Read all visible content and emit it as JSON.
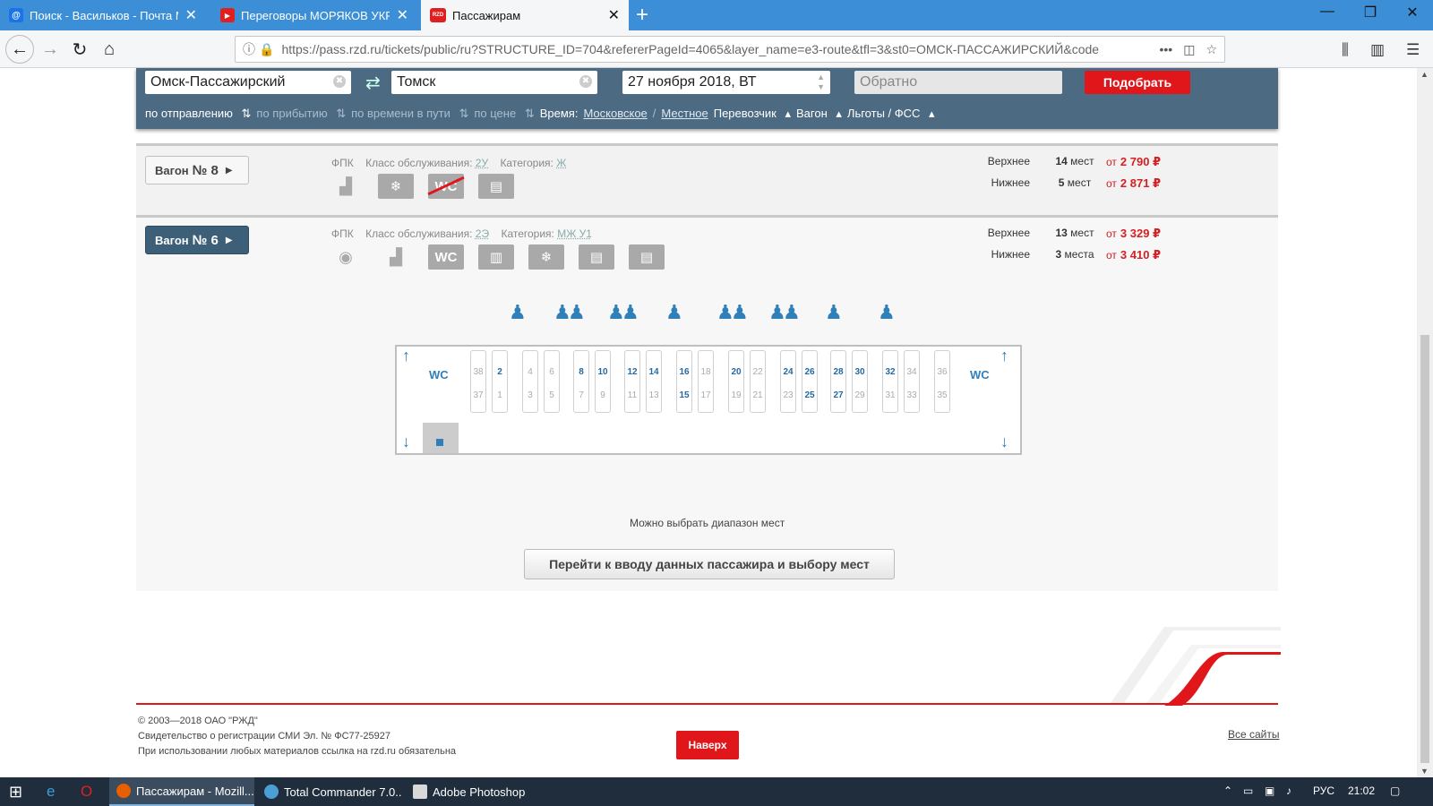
{
  "browser": {
    "tabs": [
      {
        "title": "Поиск - Васильков - Почта М",
        "fav": "@",
        "color": "#1a73e8"
      },
      {
        "title": "Переговоры МОРЯКОВ УКРА",
        "fav": "▶",
        "color": "#e02020"
      },
      {
        "title": "Пассажирам",
        "fav": "RZD",
        "color": "#e02020"
      }
    ],
    "url": "https://pass.rzd.ru/tickets/public/ru?STRUCTURE_ID=704&refererPageId=4065&layer_name=e3-route&tfl=3&st0=ОМСК-ПАССАЖИРСКИЙ&code"
  },
  "search": {
    "from": "Омск-Пассажирский",
    "to": "Томск",
    "date": "27 ноября 2018, ВТ",
    "return_placeholder": "Обратно",
    "find_label": "Подобрать",
    "sort_departure": "по отправлению",
    "sort_arrival": "по прибытию",
    "sort_travel_time": "по времени в пути",
    "sort_price": "по цене",
    "time_label": "Время:",
    "time_moscow": "Московское",
    "time_sep": "/",
    "time_local": "Местное",
    "carrier": "Перевозчик",
    "wagon": "Вагон",
    "benefits": "Льготы / ФСС"
  },
  "wagons": [
    {
      "label": "Вагон",
      "number": "№ 8",
      "carrier": "ФПК",
      "class_label": "Класс обслуживания:",
      "class": "2У",
      "category_label": "Категория:",
      "category": "Ж",
      "upper_label": "Верхнее",
      "upper_count": "14",
      "upper_unit": "мест",
      "upper_from": "от",
      "upper_price": "2 790 ₽",
      "lower_label": "Нижнее",
      "lower_count": "5",
      "lower_unit": "мест",
      "lower_from": "от",
      "lower_price": "2 871 ₽"
    },
    {
      "label": "Вагон",
      "number": "№ 6",
      "carrier": "ФПК",
      "class_label": "Класс обслуживания:",
      "class": "2Э",
      "category_label": "Категория:",
      "category": "МЖ У1",
      "upper_label": "Верхнее",
      "upper_count": "13",
      "upper_unit": "мест",
      "upper_from": "от",
      "upper_price": "3 329 ₽",
      "lower_label": "Нижнее",
      "lower_count": "3",
      "lower_unit": "места",
      "lower_from": "от",
      "lower_price": "3 410 ₽"
    }
  ],
  "seatmap": {
    "wc": "WC",
    "seats": [
      {
        "upper": "38",
        "lower": "37",
        "up_av": false,
        "lo_av": false
      },
      {
        "upper": "2",
        "lower": "1",
        "up_av": true,
        "lo_av": false
      },
      {
        "upper": "4",
        "lower": "3",
        "up_av": false,
        "lo_av": false
      },
      {
        "upper": "6",
        "lower": "5",
        "up_av": false,
        "lo_av": false
      },
      {
        "upper": "8",
        "lower": "7",
        "up_av": true,
        "lo_av": false
      },
      {
        "upper": "10",
        "lower": "9",
        "up_av": true,
        "lo_av": false
      },
      {
        "upper": "12",
        "lower": "11",
        "up_av": true,
        "lo_av": false
      },
      {
        "upper": "14",
        "lower": "13",
        "up_av": true,
        "lo_av": false
      },
      {
        "upper": "16",
        "lower": "15",
        "up_av": true,
        "lo_av": true
      },
      {
        "upper": "18",
        "lower": "17",
        "up_av": false,
        "lo_av": false
      },
      {
        "upper": "20",
        "lower": "19",
        "up_av": true,
        "lo_av": false
      },
      {
        "upper": "22",
        "lower": "21",
        "up_av": false,
        "lo_av": false
      },
      {
        "upper": "24",
        "lower": "23",
        "up_av": true,
        "lo_av": false
      },
      {
        "upper": "26",
        "lower": "25",
        "up_av": true,
        "lo_av": true
      },
      {
        "upper": "28",
        "lower": "27",
        "up_av": true,
        "lo_av": true
      },
      {
        "upper": "30",
        "lower": "29",
        "up_av": true,
        "lo_av": false
      },
      {
        "upper": "32",
        "lower": "31",
        "up_av": true,
        "lo_av": false
      },
      {
        "upper": "34",
        "lower": "33",
        "up_av": false,
        "lo_av": false
      },
      {
        "upper": "36",
        "lower": "35",
        "up_av": false,
        "lo_av": false
      }
    ]
  },
  "hint": "Можно выбрать диапазон мест",
  "go_button": "Перейти к вводу данных пассажира и выбору мест",
  "footer": {
    "copyright": "© 2003—2018  ОАО \"РЖД\"",
    "registration": "Свидетельство о регистрации СМИ Эл. № ФС77-25927",
    "notice": "При использовании любых материалов ссылка на rzd.ru обязательна",
    "top_button": "Наверх",
    "all_sites": "Все сайты"
  },
  "taskbar": {
    "apps": [
      "Пассажирам - Mozill...",
      "Total Commander 7.0...",
      "Adobe Photoshop"
    ],
    "lang": "РУС",
    "time": "21:02"
  },
  "colors": {
    "accent_red": "#e0161b",
    "panel": "#4c6b83",
    "seat_blue": "#2f80b9",
    "tab_bar": "#3c8fd6"
  }
}
